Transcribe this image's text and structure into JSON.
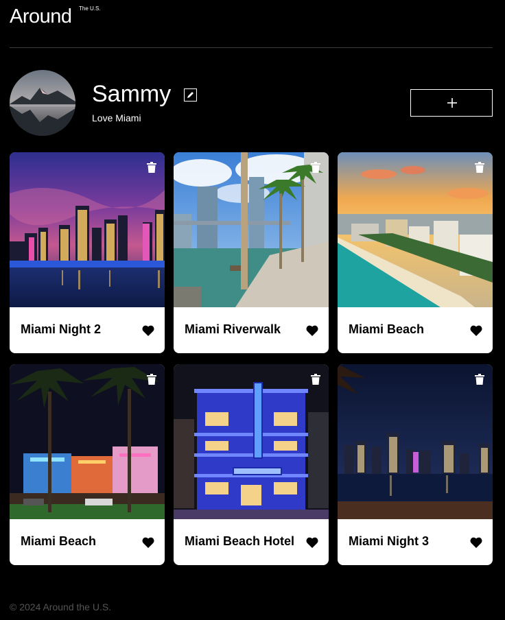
{
  "header": {
    "logo": "Around",
    "logo_sup": "The U.S."
  },
  "profile": {
    "name": "Sammy",
    "about": "Love Miami"
  },
  "cards": [
    {
      "title": "Miami Night 2"
    },
    {
      "title": "Miami Riverwalk"
    },
    {
      "title": "Miami Beach"
    },
    {
      "title": "Miami Beach"
    },
    {
      "title": "Miami Beach Hotel"
    },
    {
      "title": "Miami Night 3"
    }
  ],
  "footer": {
    "copyright": "© 2024 Around the U.S."
  },
  "icons": {
    "edit": "pencil-icon",
    "add": "plus-icon",
    "delete": "trash-icon",
    "like": "heart-icon"
  }
}
